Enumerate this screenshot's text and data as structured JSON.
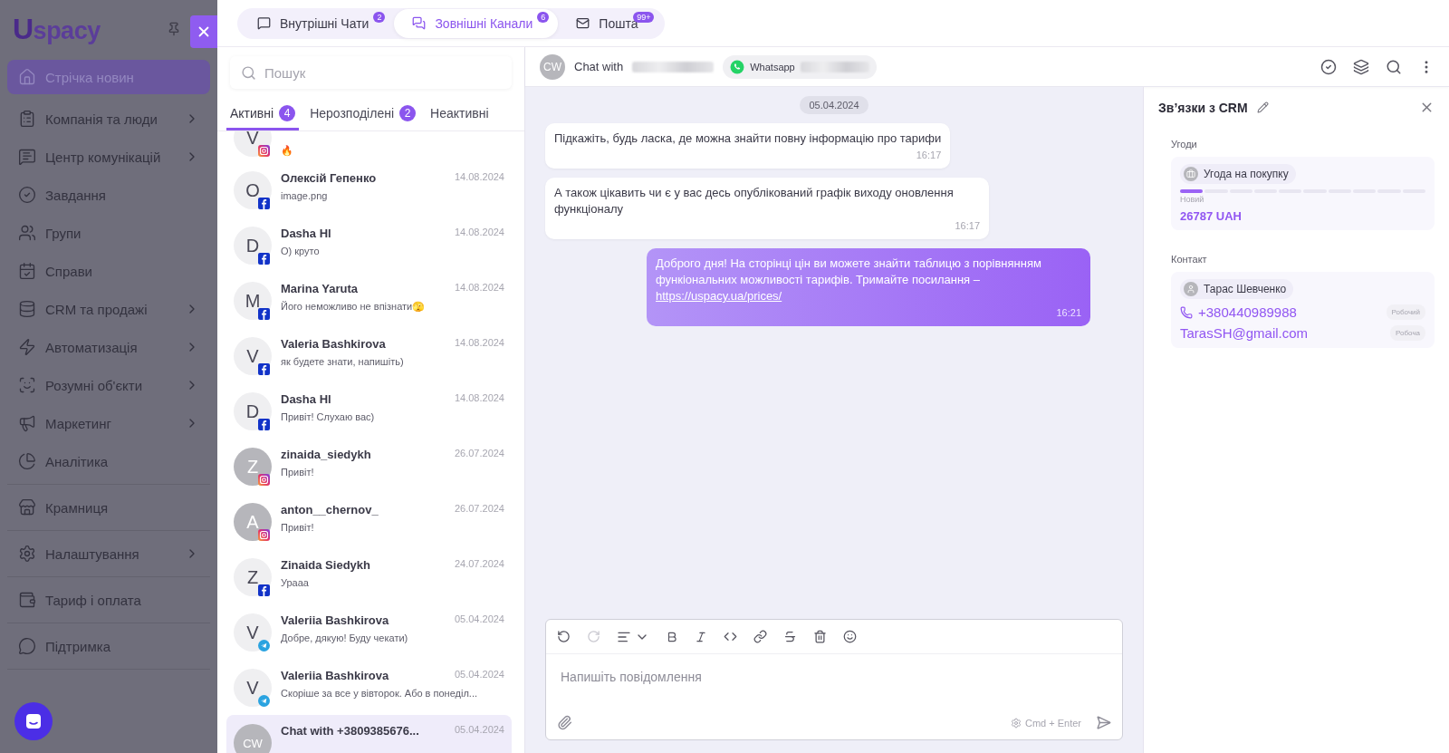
{
  "sidebar": {
    "logo_mark": "U",
    "logo": "spacy",
    "sections": [
      [
        {
          "label": "Стрічка новин",
          "selected": true,
          "expandable": false
        },
        {
          "label": "Компанія та люди",
          "selected": false,
          "expandable": true
        },
        {
          "label": "Центр комунікацій",
          "selected": false,
          "expandable": true
        },
        {
          "label": "Завдання",
          "selected": false,
          "expandable": false
        },
        {
          "label": "Групи",
          "selected": false,
          "expandable": false
        },
        {
          "label": "Справи",
          "selected": false,
          "expandable": false
        },
        {
          "label": "CRM та продажі",
          "selected": false,
          "expandable": true
        },
        {
          "label": "Автоматизація",
          "selected": false,
          "expandable": true
        },
        {
          "label": "Розумні об'єкти",
          "selected": false,
          "expandable": true
        },
        {
          "label": "Маркетинг",
          "selected": false,
          "expandable": true
        },
        {
          "label": "Аналітика",
          "selected": false,
          "expandable": false
        }
      ],
      [
        {
          "label": "Крамниця",
          "selected": false,
          "expandable": false
        }
      ],
      [
        {
          "label": "Налаштування",
          "selected": false,
          "expandable": true
        }
      ],
      [
        {
          "label": "Тариф і оплата",
          "selected": false,
          "expandable": false
        }
      ],
      [
        {
          "label": "Підтримка",
          "selected": false,
          "expandable": false
        }
      ]
    ]
  },
  "top_tabs": [
    {
      "label": "Внутрішні Чати",
      "badge": "2",
      "selected": false
    },
    {
      "label": "Зовнішні Канали",
      "badge": "6",
      "selected": true
    },
    {
      "label": "Пошта",
      "badge": "99+",
      "selected": false
    }
  ],
  "chat_list": {
    "search": {
      "placeholder": "Пошук"
    },
    "filters": [
      {
        "label": "Активні",
        "badge": "4",
        "selected": true
      },
      {
        "label": "Нерозподілені",
        "badge": "2",
        "selected": false
      },
      {
        "label": "Неактивні",
        "selected": false
      }
    ],
    "items": [
      {
        "kind": "instagram",
        "cut_off": true,
        "dark_avatar": false,
        "letter": "V",
        "preview": "🔥",
        "selected": false
      },
      {
        "kind": "facebook",
        "cut_off": false,
        "dark_avatar": false,
        "letter": "O",
        "name": "Олексій Гепенко",
        "date": "14.08.2024",
        "preview": "image.png",
        "selected": false
      },
      {
        "kind": "facebook",
        "cut_off": false,
        "dark_avatar": false,
        "letter": "D",
        "name": "Dasha Hl",
        "date": "14.08.2024",
        "preview": "О) круто",
        "selected": false
      },
      {
        "kind": "facebook",
        "cut_off": false,
        "dark_avatar": false,
        "letter": "M",
        "name": "Marina Yaruta",
        "date": "14.08.2024",
        "preview": "Його неможливо не впізнати🫣",
        "selected": false
      },
      {
        "kind": "facebook",
        "cut_off": false,
        "dark_avatar": false,
        "letter": "V",
        "name": "Valeria Bashkirova",
        "date": "14.08.2024",
        "preview": "як будете знати, напишіть)",
        "selected": false
      },
      {
        "kind": "facebook",
        "cut_off": false,
        "dark_avatar": false,
        "letter": "D",
        "name": "Dasha Hl",
        "date": "14.08.2024",
        "preview": "Привіт! Слухаю вас)",
        "selected": false
      },
      {
        "kind": "instagram",
        "cut_off": false,
        "dark_avatar": true,
        "letter": "Z",
        "name": "zinaida_siedykh",
        "date": "26.07.2024",
        "preview": "Привіт!",
        "selected": false
      },
      {
        "kind": "instagram",
        "cut_off": false,
        "dark_avatar": true,
        "letter": "A",
        "name": "anton__chernov_",
        "date": "26.07.2024",
        "preview": "Привіт!",
        "selected": false
      },
      {
        "kind": "facebook",
        "cut_off": false,
        "dark_avatar": false,
        "letter": "Z",
        "name": "Zinaida Siedykh",
        "date": "24.07.2024",
        "preview": "Урааа",
        "selected": false
      },
      {
        "kind": "telegram",
        "cut_off": false,
        "dark_avatar": false,
        "letter": "V",
        "name": "Valeriia Bashkirova",
        "date": "05.04.2024",
        "preview": "Добре, дякую! Буду чекати)",
        "selected": false
      },
      {
        "kind": "telegram",
        "cut_off": false,
        "dark_avatar": false,
        "letter": "V",
        "name": "Valeriia Bashkirova",
        "date": "05.04.2024",
        "preview": "Скоріше за все у вівторок. Або в понеділ...",
        "selected": false
      },
      {
        "kind": "plain",
        "cut_off": false,
        "dark_avatar": true,
        "letter": "CW",
        "name": "Chat with +3809385676...",
        "date": "05.04.2024",
        "selected": true
      }
    ]
  },
  "chat": {
    "avatar": "CW",
    "title": "Chat with",
    "channel": "Whatsapp",
    "date": "05.04.2024",
    "messages": [
      {
        "outgoing": false,
        "text": "Підкажіть, будь ласка, де можна знайти повну інформацію про тарифи",
        "time": "16:17"
      },
      {
        "outgoing": false,
        "text": "А також цікавить чи є у вас десь опублікований графік виходу оновлення функціоналу",
        "time": "16:17"
      },
      {
        "outgoing": true,
        "text": "Доброго дня! На сторінці цін ви можете знайти таблицю з порівнянням функіональних можливості тарифів. Тримайте посилання  –",
        "link": "https://uspacy.ua/prices/",
        "time": "16:21"
      }
    ],
    "composer": {
      "placeholder": "Напишіть повідомлення",
      "hint": "Cmd + Enter"
    }
  },
  "crm_panel": {
    "title": "Зв’язки з CRM",
    "deals_label": "Угоди",
    "deal": {
      "name": "Угода на покупку",
      "stages": [
        {
          "done": true
        },
        {
          "done": false
        },
        {
          "done": false
        },
        {
          "done": false
        },
        {
          "done": false
        },
        {
          "done": false
        },
        {
          "done": false
        },
        {
          "done": false
        },
        {
          "done": false
        },
        {
          "done": false
        }
      ],
      "stage": "Новий",
      "amount": "26787 UAH"
    },
    "contact_label": "Контакт",
    "contact": {
      "name": "Тарас Шевченко",
      "phone": "+380440989988",
      "phone_tag": "Робочий",
      "email": "TarasSH@gmail.com",
      "email_tag": "Робоча"
    }
  }
}
